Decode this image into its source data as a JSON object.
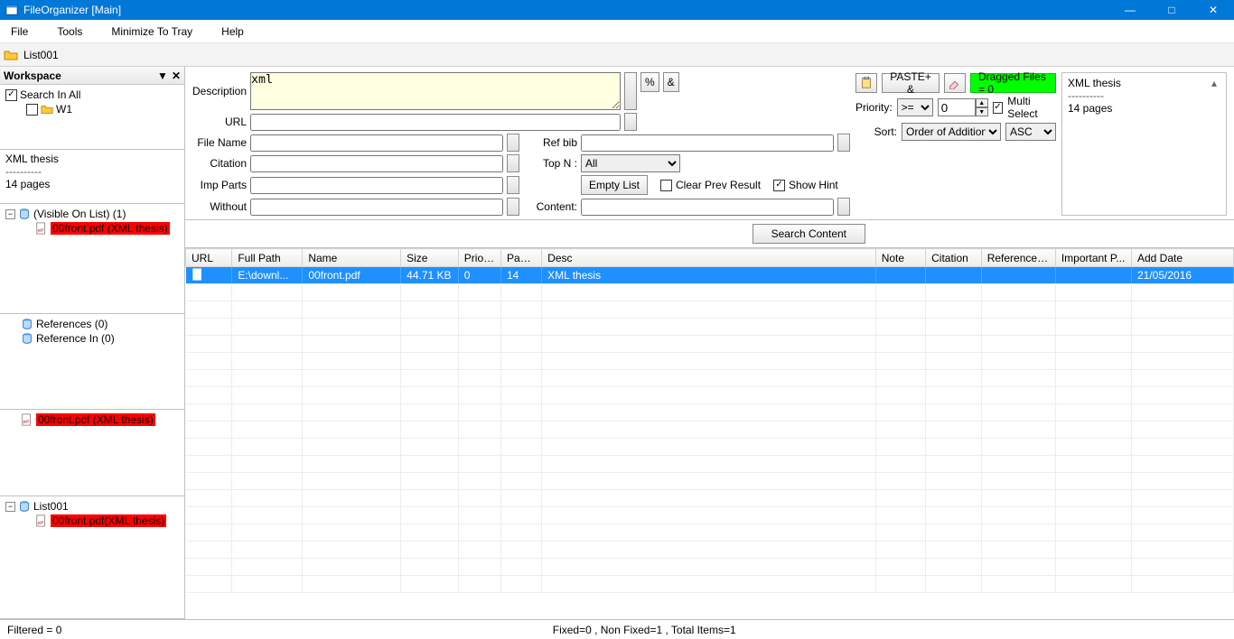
{
  "window": {
    "title": "FileOrganizer [Main]"
  },
  "menu": {
    "file": "File",
    "tools": "Tools",
    "minimize": "Minimize To Tray",
    "help": "Help"
  },
  "listbar": {
    "name": "List001"
  },
  "workspace": {
    "title": "Workspace",
    "search_in_all": "Search In All",
    "w1": "W1"
  },
  "preview_panel": {
    "line1": "XML thesis",
    "sep": "----------",
    "line2": "14 pages"
  },
  "tree_visible": {
    "label": "(Visible On List)  (1)",
    "child": "00front.pdf (XML thesis)"
  },
  "tree_refs": {
    "references": "References (0)",
    "reference_in": "Reference In (0)"
  },
  "tree_single": {
    "child": "00front.pdf (XML thesis)"
  },
  "tree_list": {
    "label": "List001",
    "child": "00front.pdf(XML thesis)"
  },
  "form": {
    "description_label": "Description",
    "description_value": "xml",
    "url_label": "URL",
    "filename_label": "File Name",
    "citation_label": "Citation",
    "impparts_label": "Imp Parts",
    "without_label": "Without",
    "refbib_label": "Ref bib",
    "topn_label": "Top N :",
    "topn_value": "All",
    "content_label": "Content:",
    "empty_list": "Empty List",
    "clear_prev": "Clear Prev Result",
    "show_hint": "Show Hint",
    "percent": "%",
    "amp": "&",
    "paste": "PASTE+ &",
    "dragged": "Dragged Files = 0",
    "priority_label": "Priority:",
    "priority_op": ">=",
    "priority_val": "0",
    "multi_select": "Multi Select",
    "sort_label": "Sort:",
    "sort_value": "Order of Addition",
    "sort_dir": "ASC",
    "search_content": "Search Content"
  },
  "side_preview": {
    "line1": "XML thesis",
    "sep": "----------",
    "line2": "14 pages"
  },
  "grid": {
    "headers": {
      "url": "URL",
      "fullpath": "Full Path",
      "name": "Name",
      "size": "Size",
      "priority": "Priority",
      "pages": "Pages",
      "desc": "Desc",
      "note": "Note",
      "citation": "Citation",
      "references": "References...",
      "important": "Important P...",
      "adddate": "Add Date"
    },
    "row": {
      "url": "",
      "fullpath": "E:\\downl...",
      "name": "00front.pdf",
      "size": "44.71 KB",
      "priority": "0",
      "pages": "14",
      "desc": "XML thesis",
      "note": "",
      "citation": "",
      "references": "",
      "important": "",
      "adddate": "21/05/2016"
    }
  },
  "status": {
    "left": "Filtered = 0",
    "center": "Fixed=0 , Non Fixed=1 , Total Items=1"
  }
}
